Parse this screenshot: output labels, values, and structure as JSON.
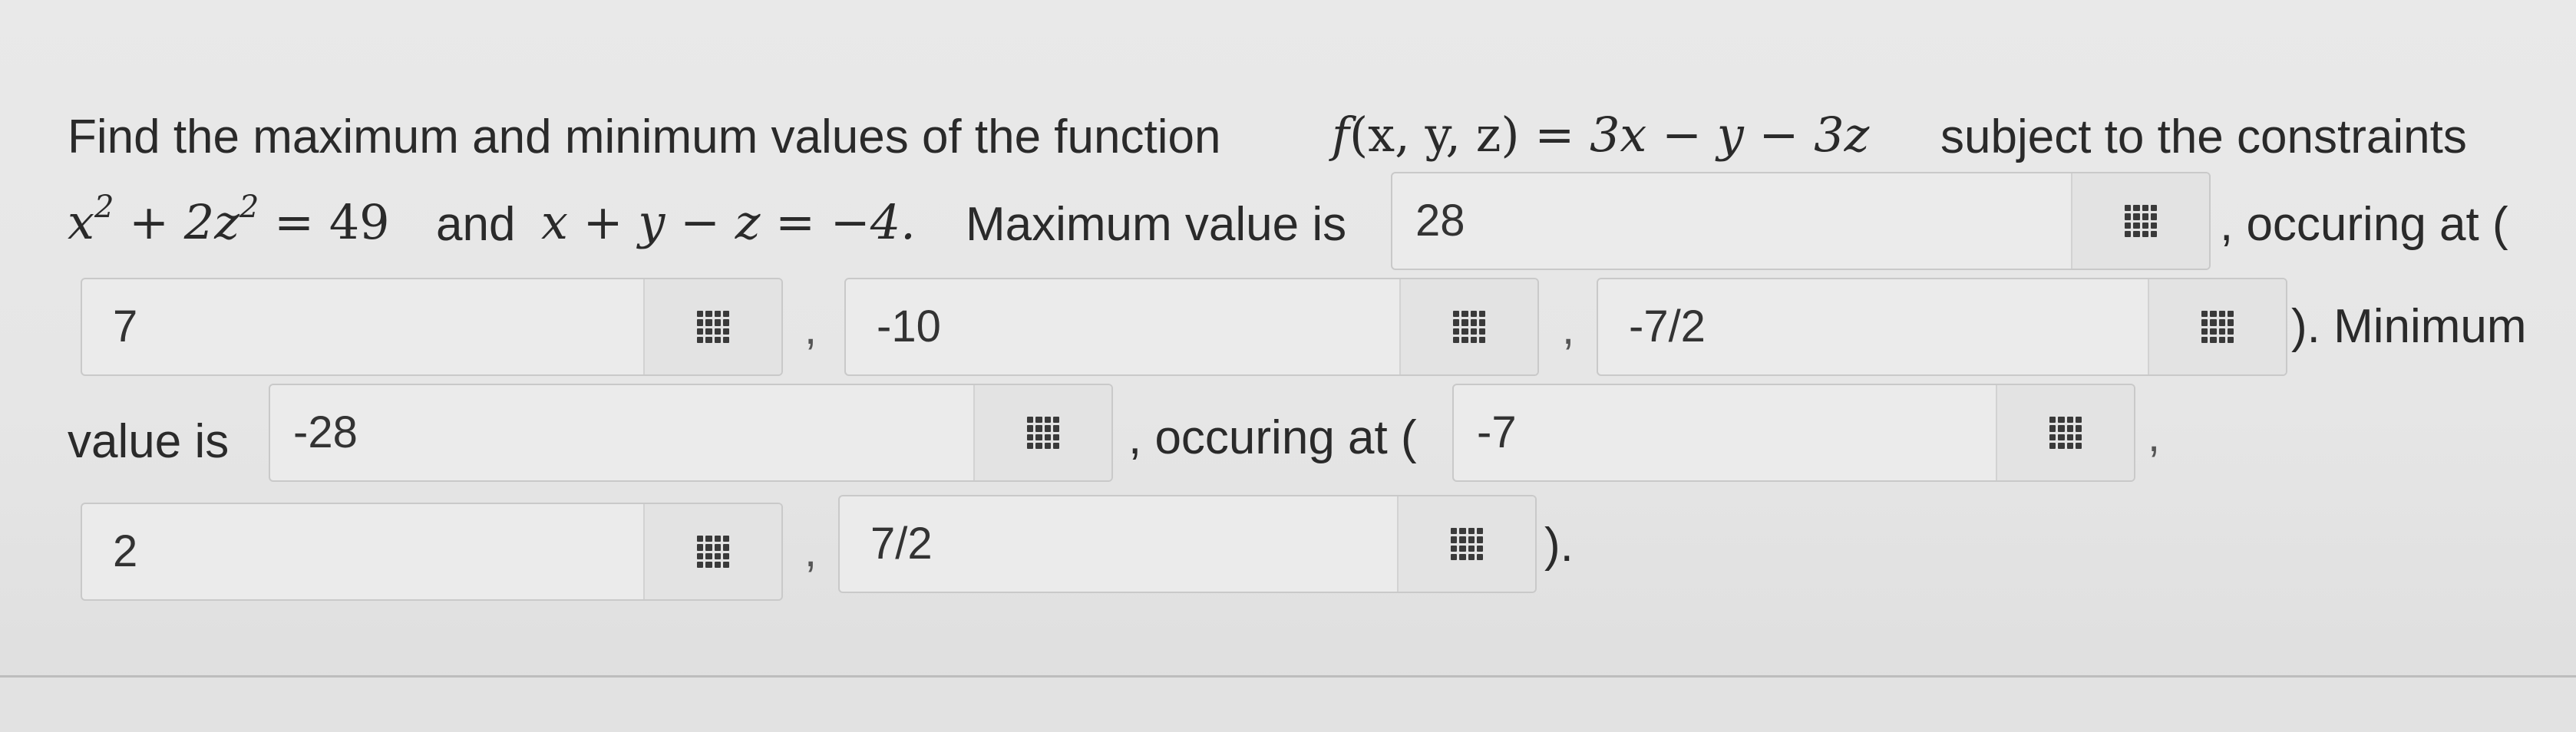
{
  "problem": {
    "intro": "Find the maximum and minimum values of the function",
    "function_lhs_name": "f",
    "function_lhs_args": "(x, y, z)",
    "equals": "=",
    "function_rhs": "3x − y − 3z",
    "constraint_phrase": "subject to the constraints",
    "constraint1_lhs": "x",
    "constraint1_exp": "2",
    "constraint1_mid": " + 2z",
    "constraint1_exp2": "2",
    "constraint1_rhs": " = 49",
    "and_word": "and",
    "constraint2": "x + y − z = −4.",
    "max_label": "Maximum value is",
    "occurring_at_open_1": ", occuring at (",
    "min_label_part1": "). Minimum",
    "min_label_part2": "value is",
    "occurring_at_open_2": ", occuring at (",
    "close_paren": ")."
  },
  "separators": {
    "comma": ","
  },
  "answers": {
    "max_value": "28",
    "max_x": "7",
    "max_y": "-10",
    "max_z": "-7/2",
    "min_value": "-28",
    "min_x": "-7",
    "min_y": "2",
    "min_z": "7/2"
  },
  "icons": {
    "keypad": "keypad-grid-icon"
  }
}
